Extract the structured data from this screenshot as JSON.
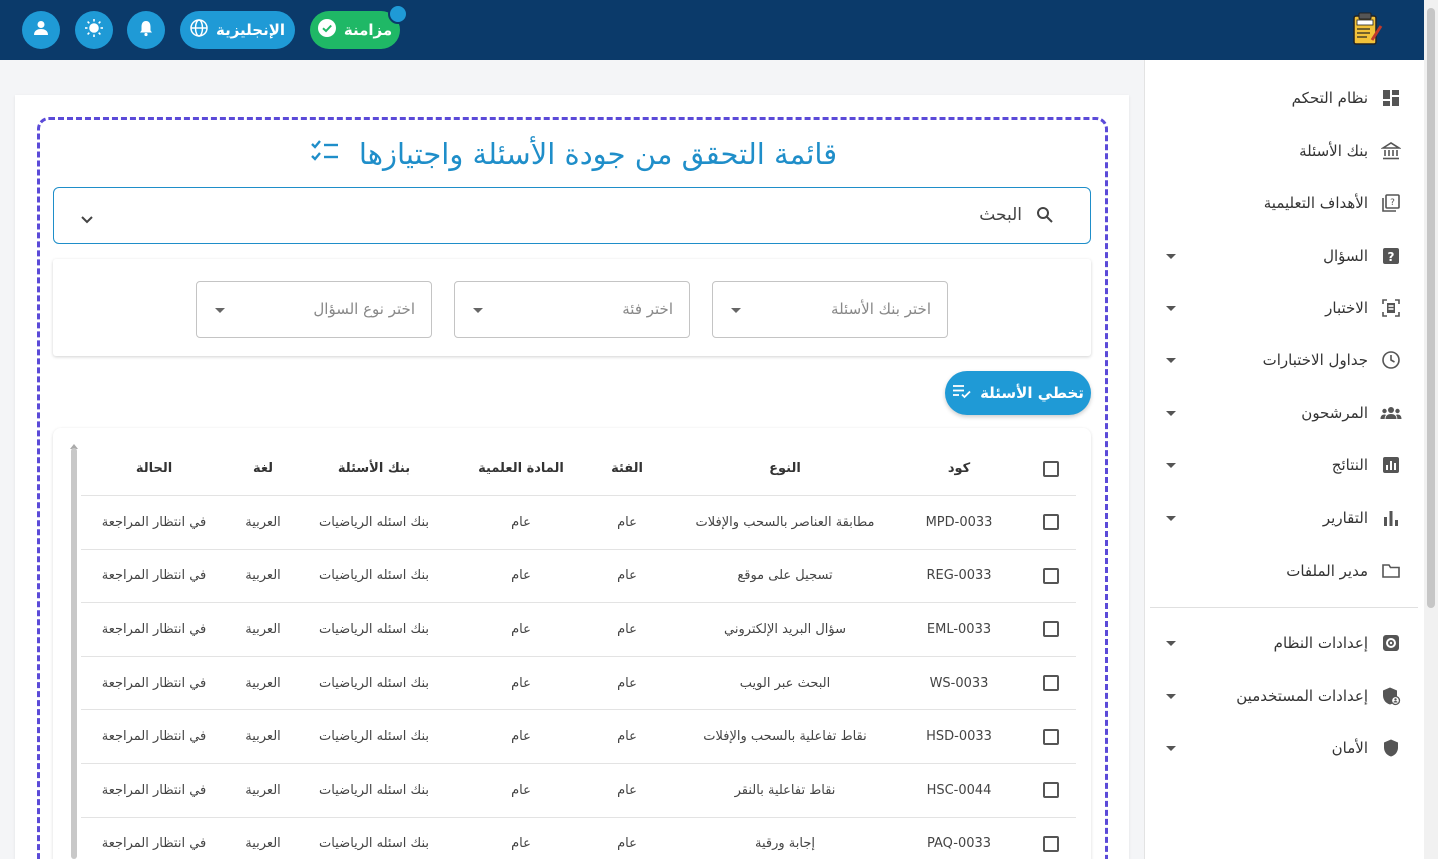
{
  "topbar": {
    "sync_label": "مزامنة",
    "language_label": "الإنجليزية",
    "icons": [
      "user-icon",
      "theme-icon",
      "bell-icon",
      "globe-icon",
      "check-circle-icon",
      "exam-logo-icon"
    ]
  },
  "sidebar": {
    "items": [
      {
        "label": "نظام التحكم",
        "icon": "dashboard-icon",
        "expandable": false
      },
      {
        "label": "بنك الأسئلة",
        "icon": "bank-icon",
        "expandable": false
      },
      {
        "label": "الأهداف التعليمية",
        "icon": "quiz-book-icon",
        "expandable": false
      },
      {
        "label": "السؤال",
        "icon": "question-icon",
        "expandable": true
      },
      {
        "label": "الاختبار",
        "icon": "exam-icon",
        "expandable": true
      },
      {
        "label": "جداول الاختبارات",
        "icon": "clock-icon",
        "expandable": true
      },
      {
        "label": "المرشحون",
        "icon": "people-icon",
        "expandable": true
      },
      {
        "label": "النتائج",
        "icon": "results-chart-icon",
        "expandable": true
      },
      {
        "label": "التقارير",
        "icon": "bar-chart-icon",
        "expandable": true
      },
      {
        "label": "مدير الملفات",
        "icon": "folder-icon",
        "expandable": false
      },
      {
        "label": "إعدادات النظام",
        "icon": "settings-icon",
        "expandable": true
      },
      {
        "label": "إعدادات المستخدمين",
        "icon": "user-shield-icon",
        "expandable": true
      },
      {
        "label": "الأمان",
        "icon": "shield-icon",
        "expandable": true
      }
    ]
  },
  "main": {
    "title": "قائمة التحقق من جودة الأسئلة واجتيازها",
    "search_label": "البحث",
    "filters": {
      "bank_placeholder": "اختر بنك الأسئلة",
      "category_placeholder": "اختر فئة",
      "type_placeholder": "اختر نوع السؤال"
    },
    "skip_button": "تخطي الأسئلة",
    "table": {
      "headers": {
        "code": "كود",
        "type": "النوع",
        "category": "الفئة",
        "subject": "المادة العلمية",
        "bank": "بنك الأسئلة",
        "language": "لغة",
        "status": "الحالة"
      },
      "rows": [
        {
          "code": "MPD-0033",
          "type": "مطابقة العناصر بالسحب والإفلات",
          "category": "عام",
          "subject": "عام",
          "bank": "بنك اسئله الرياضيات",
          "language": "العربية",
          "status": "في انتظار المراجعة"
        },
        {
          "code": "REG-0033",
          "type": "تسجيل على موقع",
          "category": "عام",
          "subject": "عام",
          "bank": "بنك اسئله الرياضيات",
          "language": "العربية",
          "status": "في انتظار المراجعة"
        },
        {
          "code": "EML-0033",
          "type": "سؤال البريد الإلكتروني",
          "category": "عام",
          "subject": "عام",
          "bank": "بنك اسئله الرياضيات",
          "language": "العربية",
          "status": "في انتظار المراجعة"
        },
        {
          "code": "WS-0033",
          "type": "البحث عبر الويب",
          "category": "عام",
          "subject": "عام",
          "bank": "بنك اسئله الرياضيات",
          "language": "العربية",
          "status": "في انتظار المراجعة"
        },
        {
          "code": "HSD-0033",
          "type": "نقاط تفاعلية بالسحب والإفلات",
          "category": "عام",
          "subject": "عام",
          "bank": "بنك اسئله الرياضيات",
          "language": "العربية",
          "status": "في انتظار المراجعة"
        },
        {
          "code": "HSC-0044",
          "type": "نقاط تفاعلية بالنقر",
          "category": "عام",
          "subject": "عام",
          "bank": "بنك اسئله الرياضيات",
          "language": "العربية",
          "status": "في انتظار المراجعة"
        },
        {
          "code": "PAQ-0033",
          "type": "إجابة ورقية",
          "category": "عام",
          "subject": "عام",
          "bank": "بنك اسئله الرياضيات",
          "language": "العربية",
          "status": "في انتظار المراجعة"
        }
      ]
    }
  },
  "colors": {
    "topbar": "#0b3a6a",
    "accent": "#1f9ad6",
    "sync": "#1fb866",
    "title": "#1f8ec9",
    "frame": "#5b4ad8"
  }
}
